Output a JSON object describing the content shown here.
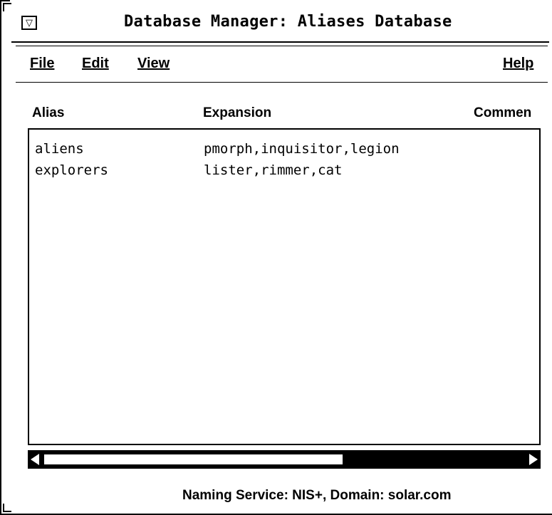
{
  "window": {
    "title": "Database Manager: Aliases Database",
    "menu_button_glyph": "▽"
  },
  "menubar": {
    "items": [
      {
        "label": "File"
      },
      {
        "label": "Edit"
      },
      {
        "label": "View"
      },
      {
        "label": "Help"
      }
    ]
  },
  "table": {
    "columns": [
      "Alias",
      "Expansion",
      "Commen"
    ],
    "rows": [
      {
        "alias": "aliens",
        "expansion": "pmorph,inquisitor,legion",
        "comment": ""
      },
      {
        "alias": "explorers",
        "expansion": "lister,rimmer,cat",
        "comment": ""
      }
    ]
  },
  "scrollbar": {
    "horizontal_thumb_fraction": 0.62
  },
  "status": {
    "text": "Naming Service: NIS+, Domain: solar.com"
  },
  "icons": {
    "window_menu": "window-menu-icon",
    "scroll_left": "arrow-left-icon",
    "scroll_right": "arrow-right-icon"
  }
}
